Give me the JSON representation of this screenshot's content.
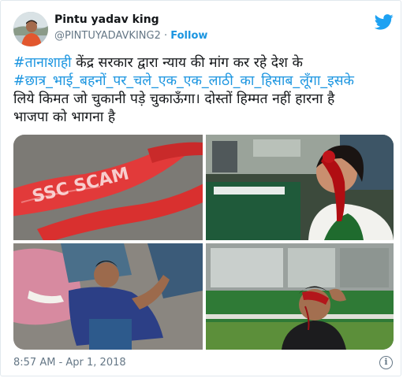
{
  "author": {
    "name": "Pintu yadav king",
    "handle": "@PINTUYADAVKING2",
    "separator": "·",
    "follow_label": "Follow"
  },
  "tweet": {
    "line1_tag": "#तानाशाही",
    "line1_text": " केंद्र सरकार द्वारा न्याय की मांग कर रहे देश के",
    "line2_tag": "#छात्र_भाई_बहनों_पर_चले_एक_एक_लाठी_का_हिसाब_लूँगा_इसके",
    "line3_text": "लिये किमत जो चुकानी पड़े चुकाऊँगा। दोस्तों हिम्मत नहीं हारना है",
    "line4_text": "भाजपा को भागना है"
  },
  "media": {
    "photo1_banner_text": "SSC SCAM"
  },
  "footer": {
    "timestamp": "8:57 AM - Apr 1, 2018",
    "info_glyph": "i"
  },
  "colors": {
    "link": "#1b95e0",
    "text": "#14171a",
    "muted": "#657786",
    "border": "#e1e8ed",
    "twitter_blue": "#1da1f2"
  },
  "icons": {
    "brand": "twitter-bird-icon",
    "info": "info-circle-icon"
  }
}
